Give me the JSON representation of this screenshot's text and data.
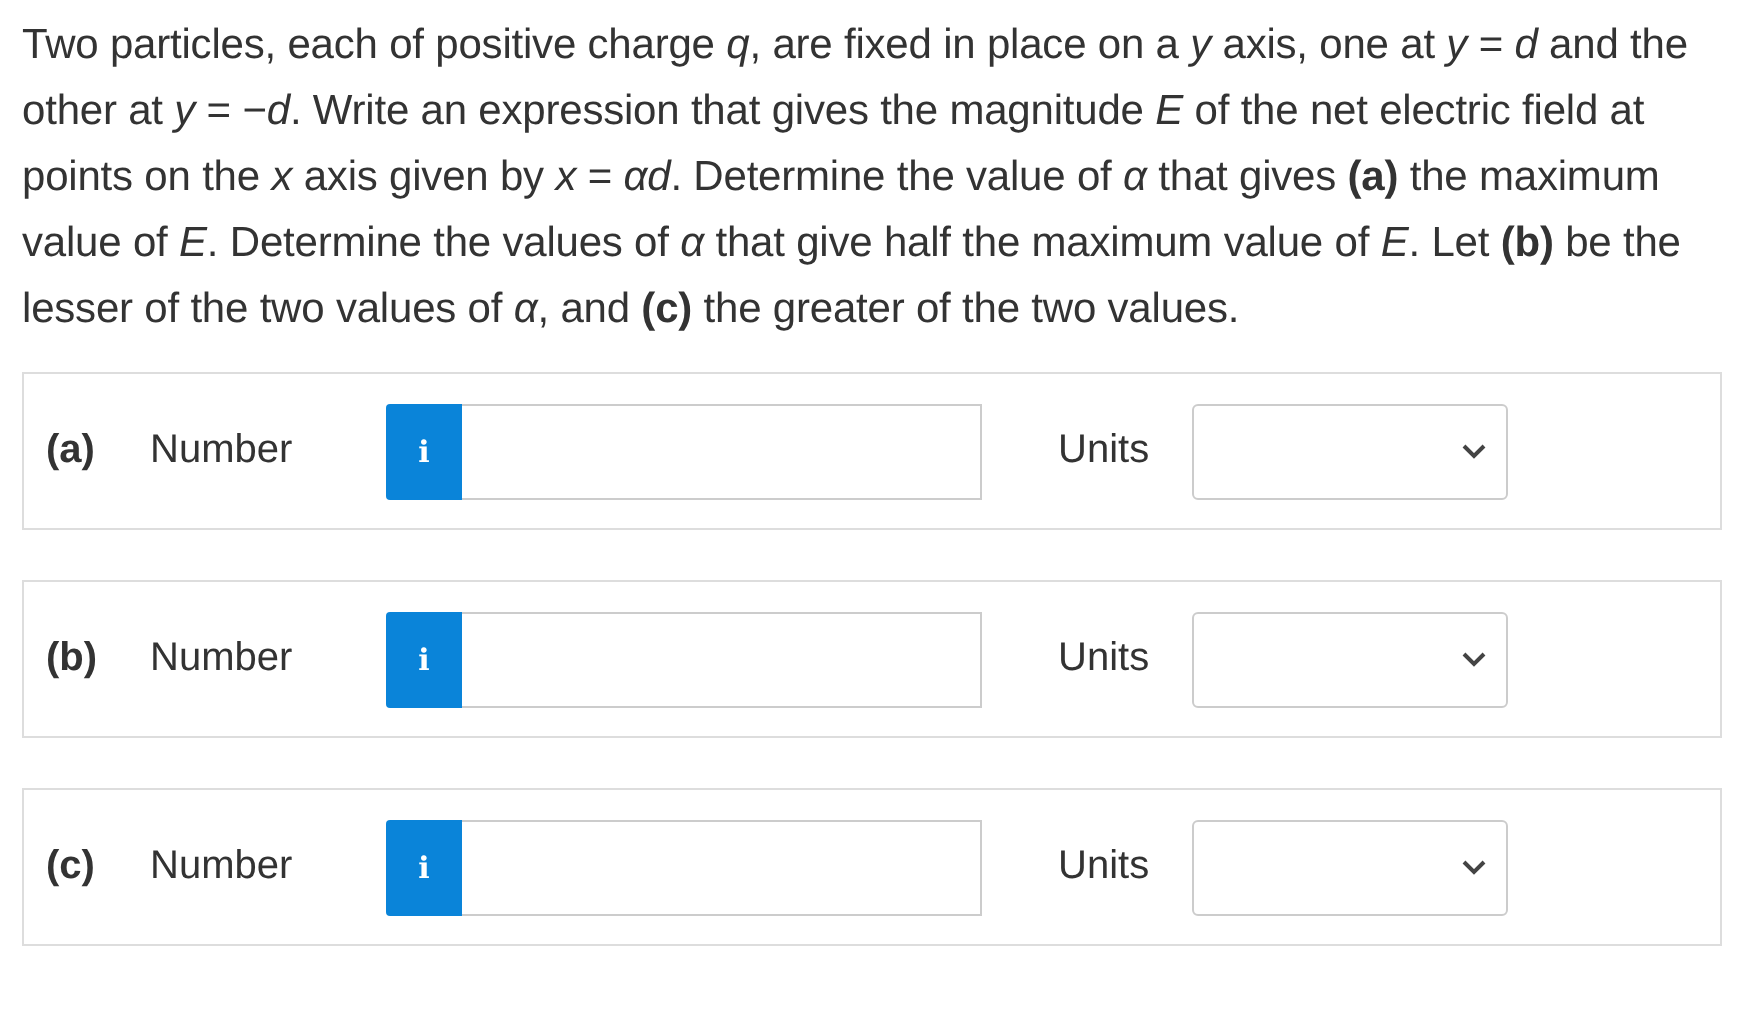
{
  "question": "Two particles, each of positive charge *q*, are fixed in place on a *y* axis, one at *y* = *d* and the other at *y* = −*d*. Write an expression that gives the magnitude *E* of the net electric field at points on the *x* axis given by *x* = *αd*. Determine the value of *α* that gives **(a)** the maximum value of *E*. Determine the values of *α* that give half the maximum value of *E*. Let **(b)** be the lesser of the two values of *α*, and **(c)** the greater of the two values.",
  "parts": [
    {
      "label": "(a)",
      "number_label": "Number",
      "info_button": "i",
      "units_label": "Units"
    },
    {
      "label": "(b)",
      "number_label": "Number",
      "info_button": "i",
      "units_label": "Units"
    },
    {
      "label": "(c)",
      "number_label": "Number",
      "info_button": "i",
      "units_label": "Units"
    }
  ]
}
